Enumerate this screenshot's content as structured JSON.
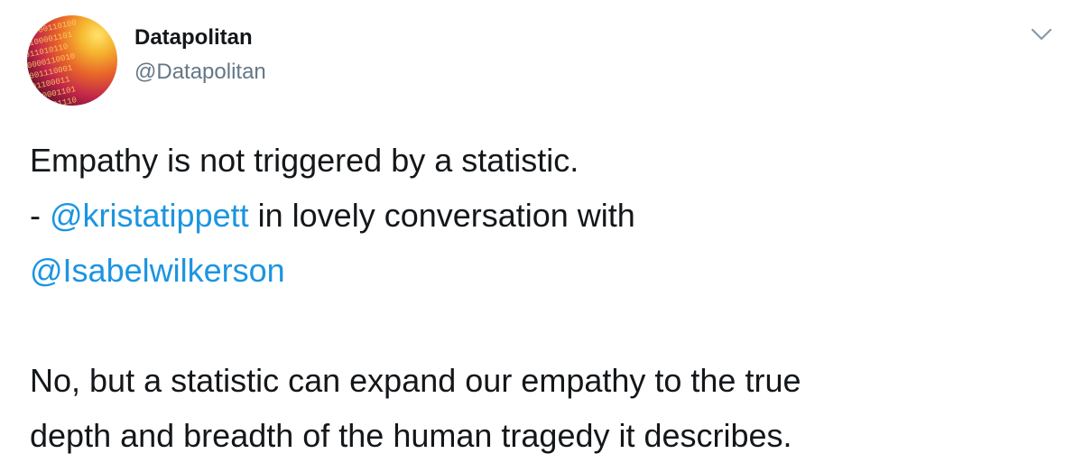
{
  "author": {
    "display_name": "Datapolitan",
    "handle": "@Datapolitan",
    "avatar_icon": "binary-code-avatar"
  },
  "menu_icon": "chevron-down-icon",
  "tweet": {
    "line1": "Empathy is not triggered by a statistic.",
    "line2_prefix": "- ",
    "mention1": "@kristatippett",
    "line2_suffix": " in lovely conversation with",
    "mention2": "@Isabelwilkerson",
    "line4": "No, but a statistic can expand our empathy to the true",
    "line5": "depth and breadth of the human tragedy it describes."
  },
  "colors": {
    "link": "#1b95e0",
    "text": "#14171a",
    "secondary": "#657786"
  }
}
